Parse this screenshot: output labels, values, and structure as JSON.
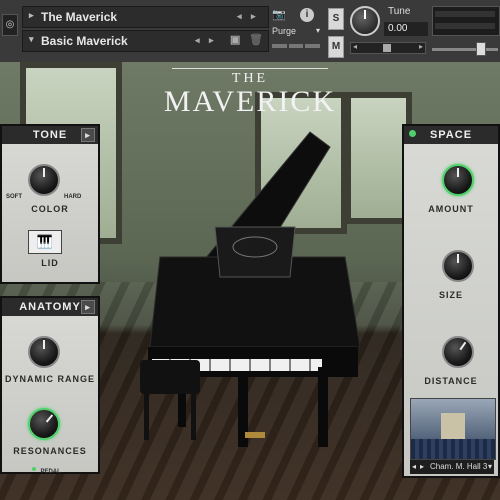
{
  "header": {
    "instrument_name": "The Maverick",
    "preset_name": "Basic Maverick",
    "purge_label": "Purge",
    "s_button": "S",
    "m_button": "M",
    "tune_label": "Tune",
    "tune_value": "0.00"
  },
  "logo": {
    "line1": "THE",
    "line2": "MAVERICK"
  },
  "tone": {
    "title": "TONE",
    "soft_label": "SOFT",
    "hard_label": "HARD",
    "color_label": "COLOR",
    "lid_label": "LID"
  },
  "anatomy": {
    "title": "ANATOMY",
    "dynamic_range_label": "DYNAMIC RANGE",
    "resonances_label": "RESONANCES",
    "pedal_label": "PEDAL"
  },
  "space": {
    "title": "SPACE",
    "amount_label": "AMOUNT",
    "size_label": "SIZE",
    "distance_label": "DISTANCE",
    "room_name": "Cham. M. Hall 3"
  },
  "colors": {
    "accent_green": "#4fd06b",
    "panel_bg": "#d0d1cc",
    "header_bg": "#3a3a3a"
  }
}
